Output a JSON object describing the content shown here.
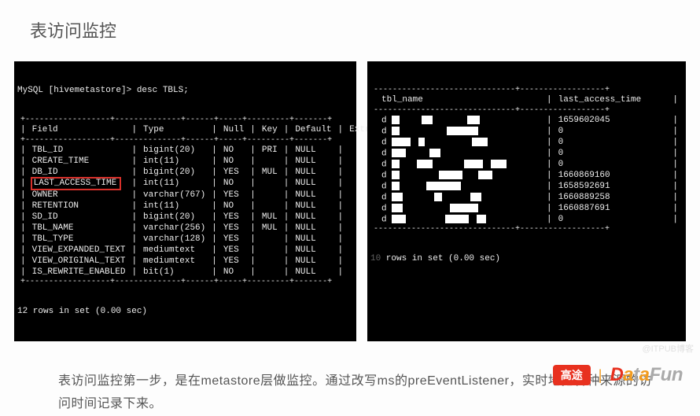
{
  "title": "表访问监控",
  "left": {
    "prompt": "MySQL [hivemetastore]> desc TBLS;",
    "headers": [
      "Field",
      "Type",
      "Null",
      "Key",
      "Default",
      "Extra"
    ],
    "rows": [
      {
        "f": "TBL_ID",
        "t": "bigint(20)",
        "n": "NO",
        "k": "PRI",
        "d": "NULL",
        "e": "",
        "hl": false
      },
      {
        "f": "CREATE_TIME",
        "t": "int(11)",
        "n": "NO",
        "k": "",
        "d": "NULL",
        "e": "",
        "hl": false
      },
      {
        "f": "DB_ID",
        "t": "bigint(20)",
        "n": "YES",
        "k": "MUL",
        "d": "NULL",
        "e": "",
        "hl": false
      },
      {
        "f": "LAST_ACCESS_TIME",
        "t": "int(11)",
        "n": "NO",
        "k": "",
        "d": "NULL",
        "e": "",
        "hl": true
      },
      {
        "f": "OWNER",
        "t": "varchar(767)",
        "n": "YES",
        "k": "",
        "d": "NULL",
        "e": "",
        "hl": false
      },
      {
        "f": "RETENTION",
        "t": "int(11)",
        "n": "NO",
        "k": "",
        "d": "NULL",
        "e": "",
        "hl": false
      },
      {
        "f": "SD_ID",
        "t": "bigint(20)",
        "n": "YES",
        "k": "MUL",
        "d": "NULL",
        "e": "",
        "hl": false
      },
      {
        "f": "TBL_NAME",
        "t": "varchar(256)",
        "n": "YES",
        "k": "MUL",
        "d": "NULL",
        "e": "",
        "hl": false
      },
      {
        "f": "TBL_TYPE",
        "t": "varchar(128)",
        "n": "YES",
        "k": "",
        "d": "NULL",
        "e": "",
        "hl": false
      },
      {
        "f": "VIEW_EXPANDED_TEXT",
        "t": "mediumtext",
        "n": "YES",
        "k": "",
        "d": "NULL",
        "e": "",
        "hl": false
      },
      {
        "f": "VIEW_ORIGINAL_TEXT",
        "t": "mediumtext",
        "n": "YES",
        "k": "",
        "d": "NULL",
        "e": "",
        "hl": false
      },
      {
        "f": "IS_REWRITE_ENABLED",
        "t": "bit(1)",
        "n": "NO",
        "k": "",
        "d": "NULL",
        "e": "",
        "hl": false
      }
    ],
    "footer": "12 rows in set (0.00 sec)"
  },
  "right": {
    "headers": [
      "tbl_name",
      "last_access_time"
    ],
    "rows": [
      {
        "v": "1659602045"
      },
      {
        "v": "0"
      },
      {
        "v": "0"
      },
      {
        "v": "0"
      },
      {
        "v": "0"
      },
      {
        "v": "1660869160"
      },
      {
        "v": "1658592691"
      },
      {
        "v": "1660889258"
      },
      {
        "v": "1660887691"
      },
      {
        "v": "0"
      }
    ],
    "footer_cut": " rows in set (0.00 sec)"
  },
  "desc": "表访问监控第一步，是在metastore层做监控。通过改写ms的preEventListener，实时地把各种来源的访问时间记录下来。",
  "logos": {
    "gt": "高途",
    "sep": "|",
    "df_d": "D",
    "df_a": "a",
    "df_t": "t",
    "df_a2": "a",
    "df_fun": "Fun"
  },
  "chart_data": {
    "type": "table",
    "title": "desc TBLS",
    "columns": [
      "Field",
      "Type",
      "Null",
      "Key",
      "Default",
      "Extra"
    ],
    "rows": [
      [
        "TBL_ID",
        "bigint(20)",
        "NO",
        "PRI",
        "NULL",
        ""
      ],
      [
        "CREATE_TIME",
        "int(11)",
        "NO",
        "",
        "NULL",
        ""
      ],
      [
        "DB_ID",
        "bigint(20)",
        "YES",
        "MUL",
        "NULL",
        ""
      ],
      [
        "LAST_ACCESS_TIME",
        "int(11)",
        "NO",
        "",
        "NULL",
        ""
      ],
      [
        "OWNER",
        "varchar(767)",
        "YES",
        "",
        "NULL",
        ""
      ],
      [
        "RETENTION",
        "int(11)",
        "NO",
        "",
        "NULL",
        ""
      ],
      [
        "SD_ID",
        "bigint(20)",
        "YES",
        "MUL",
        "NULL",
        ""
      ],
      [
        "TBL_NAME",
        "varchar(256)",
        "YES",
        "MUL",
        "NULL",
        ""
      ],
      [
        "TBL_TYPE",
        "varchar(128)",
        "YES",
        "",
        "NULL",
        ""
      ],
      [
        "VIEW_EXPANDED_TEXT",
        "mediumtext",
        "YES",
        "",
        "NULL",
        ""
      ],
      [
        "VIEW_ORIGINAL_TEXT",
        "mediumtext",
        "YES",
        "",
        "NULL",
        ""
      ],
      [
        "IS_REWRITE_ENABLED",
        "bit(1)",
        "NO",
        "",
        "NULL",
        ""
      ]
    ]
  }
}
